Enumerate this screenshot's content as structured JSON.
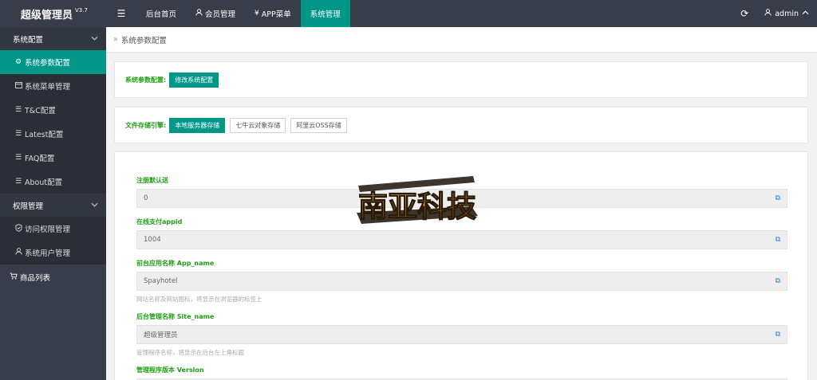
{
  "app": {
    "title": "超级管理员",
    "version": "V3.7"
  },
  "topnav": {
    "menu_icon": "hamburger-icon",
    "items": [
      {
        "label": "后台首页",
        "icon": ""
      },
      {
        "label": "会员管理",
        "icon": "user-icon"
      },
      {
        "label": "APP菜单",
        "icon": "yen-icon"
      },
      {
        "label": "系统管理",
        "icon": "",
        "active": true
      }
    ],
    "refresh_icon": "refresh-icon",
    "user": "admin"
  },
  "sidebar": {
    "groups": [
      {
        "label": "系统配置",
        "items": [
          {
            "label": "系统参数配置",
            "icon": "gear-icon",
            "active": true
          },
          {
            "label": "系统菜单管理",
            "icon": "window-icon"
          },
          {
            "label": "T&C配置",
            "icon": "list-icon"
          },
          {
            "label": "Latest配置",
            "icon": "list-icon"
          },
          {
            "label": "FAQ配置",
            "icon": "list-icon"
          },
          {
            "label": "About配置",
            "icon": "list-icon"
          }
        ]
      },
      {
        "label": "权限管理",
        "items": [
          {
            "label": "访问权限管理",
            "icon": "shield-icon"
          },
          {
            "label": "系统用户管理",
            "icon": "user-icon"
          }
        ]
      }
    ],
    "extra": {
      "label": "商品列表",
      "icon": "cart-icon"
    }
  },
  "breadcrumb": "系统参数配置",
  "config_card": {
    "label": "系统参数配置:",
    "button": "修改系统配置"
  },
  "storage_card": {
    "label": "文件存储引擎:",
    "buttons": [
      "本地服务器存储",
      "七牛云对象存储",
      "阿里云OSS存储"
    ]
  },
  "fields": [
    {
      "label": "注册默认送",
      "value": "0",
      "help": ""
    },
    {
      "label": "在线支付appid",
      "value": "1004",
      "help": ""
    },
    {
      "label": "前台应用名称 App_name",
      "value": "Spayhotel",
      "help": "网站名称及网站图标，将显示在浏览器的标签上"
    },
    {
      "label": "后台管理名称 Site_name",
      "value": "超级管理员",
      "help": "管理程序名称，将显示在后台左上角标题"
    },
    {
      "label": "管理程序版本 Version",
      "value": "",
      "help": ""
    }
  ],
  "watermark": {
    "text": "南亚科技"
  },
  "colors": {
    "accent": "#009688",
    "dark": "#393d49",
    "label_green": "#1e9f13",
    "copy_blue": "#2c7be0"
  }
}
